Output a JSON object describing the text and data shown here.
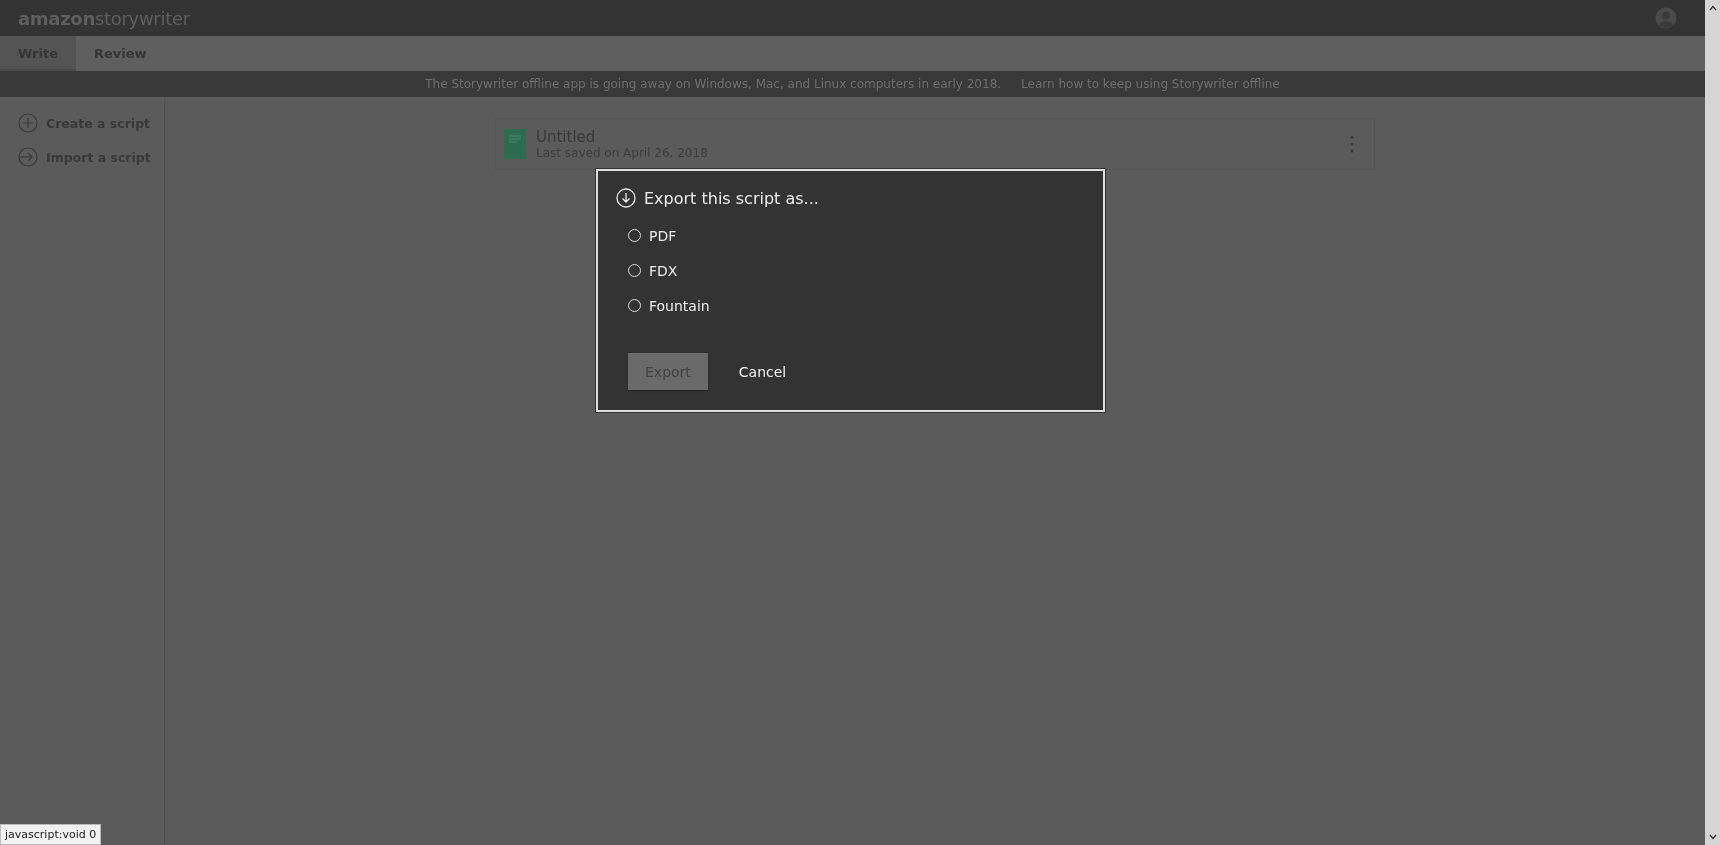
{
  "header": {
    "logo": "**amazon**storywriter"
  },
  "tabs": [
    {
      "label": "Write",
      "selected": true
    },
    {
      "label": "Review",
      "selected": false
    }
  ],
  "banner": {
    "message": "The Storywriter offline app is going away on Windows, Mac, and Linux computers in early 2018.",
    "link": "Learn how to keep using Storywriter offline"
  },
  "sidebar": {
    "items": [
      {
        "kind": "create",
        "label": "Create a script"
      },
      {
        "kind": "import",
        "label": "Import a script"
      }
    ]
  },
  "scripts": [
    {
      "title": "Untitled",
      "saved": "Last saved on April 26, 2018"
    }
  ],
  "dialog": {
    "title": "Export this script as...",
    "options": [
      {
        "label": "PDF",
        "selected": false
      },
      {
        "label": "FDX",
        "selected": false
      },
      {
        "label": "Fountain",
        "selected": false
      }
    ],
    "buttons": [
      {
        "kind": "primary",
        "label": "Export",
        "disabled": true
      },
      {
        "kind": "link",
        "label": "Cancel",
        "disabled": false
      }
    ]
  },
  "status_url": "javascript:void 0"
}
